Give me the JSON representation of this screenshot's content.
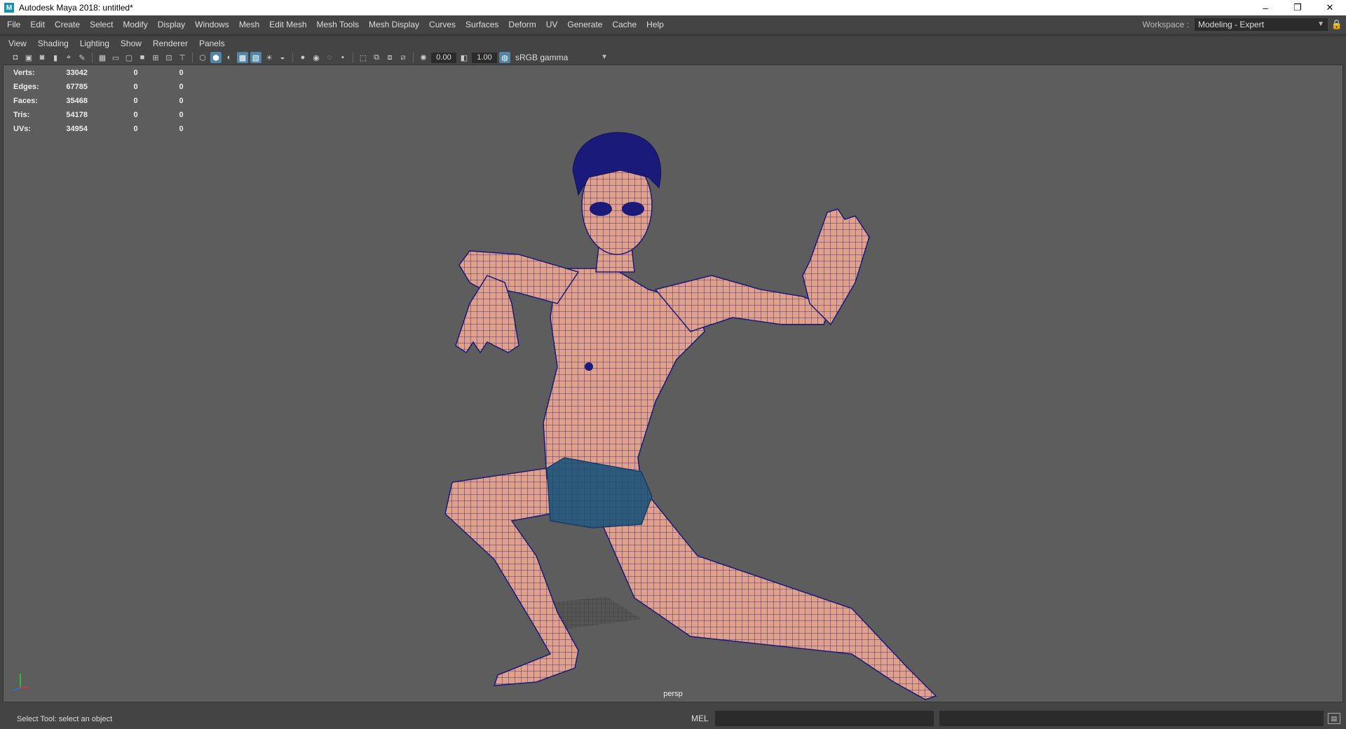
{
  "window": {
    "title": "Autodesk Maya 2018: untitled*",
    "app_icon": "M",
    "minimize": "–",
    "restore": "❐",
    "close": "✕"
  },
  "menubar": {
    "items": [
      "File",
      "Edit",
      "Create",
      "Select",
      "Modify",
      "Display",
      "Windows",
      "Mesh",
      "Edit Mesh",
      "Mesh Tools",
      "Mesh Display",
      "Curves",
      "Surfaces",
      "Deform",
      "UV",
      "Generate",
      "Cache",
      "Help"
    ],
    "workspace_label": "Workspace :",
    "workspace_value": "Modeling - Expert"
  },
  "panel_menu": {
    "items": [
      "View",
      "Shading",
      "Lighting",
      "Show",
      "Renderer",
      "Panels"
    ]
  },
  "panel_toolbar": {
    "exposure": "0.00",
    "gamma": "1.00",
    "colorspace": "sRGB gamma"
  },
  "hud": {
    "rows": [
      {
        "label": "Verts:",
        "value": "33042",
        "sel": "0",
        "comp": "0"
      },
      {
        "label": "Edges:",
        "value": "67785",
        "sel": "0",
        "comp": "0"
      },
      {
        "label": "Faces:",
        "value": "35468",
        "sel": "0",
        "comp": "0"
      },
      {
        "label": "Tris:",
        "value": "54178",
        "sel": "0",
        "comp": "0"
      },
      {
        "label": "UVs:",
        "value": "34954",
        "sel": "0",
        "comp": "0"
      }
    ]
  },
  "viewport": {
    "camera": "persp",
    "background_color": "#5d5d5d",
    "mesh_color": "#e0a08a",
    "wire_color": "#1a1a7a",
    "shorts_color": "#2d5a7a"
  },
  "status": {
    "help_line": "Select Tool: select an object",
    "command_lang": "MEL"
  }
}
